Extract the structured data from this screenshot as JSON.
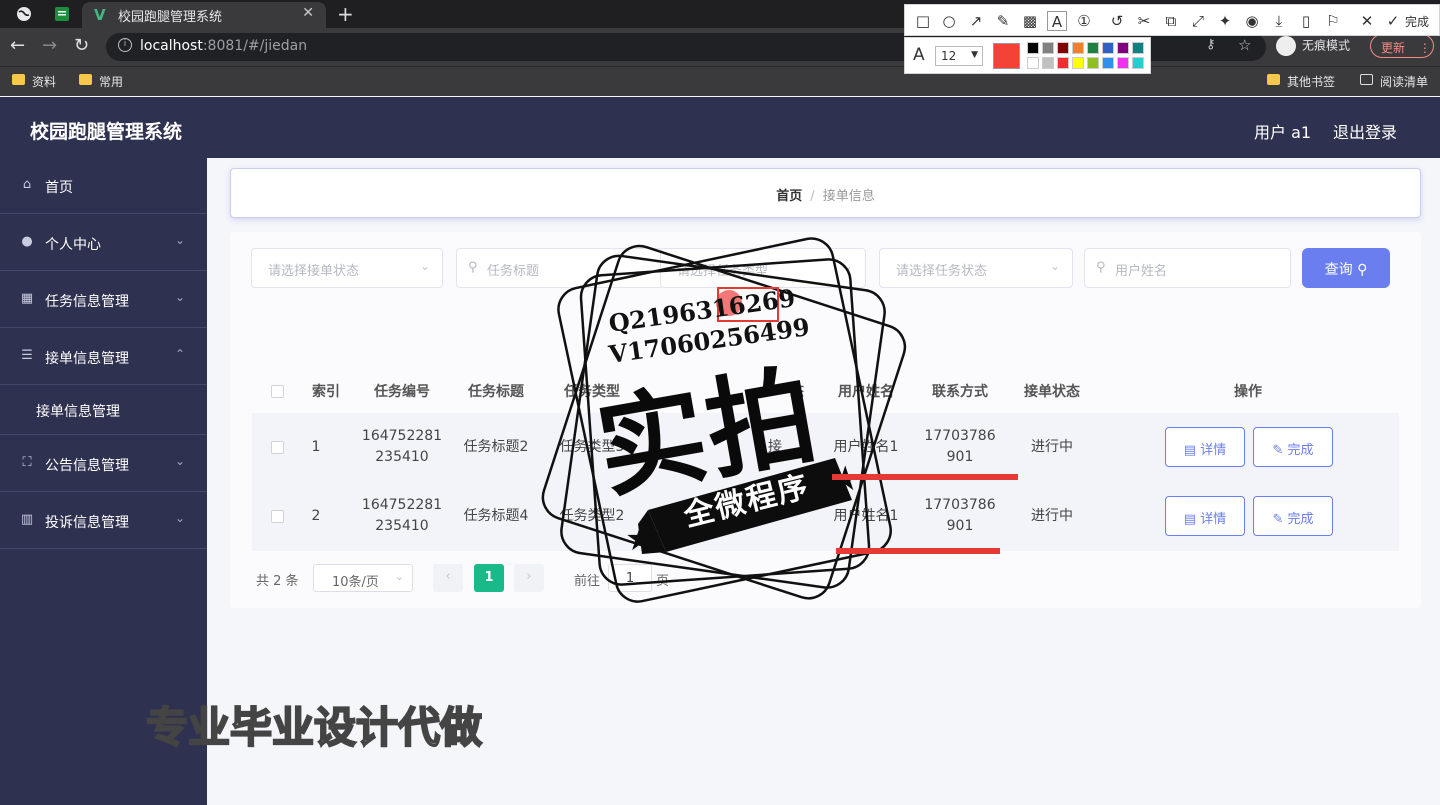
{
  "browser": {
    "tab_title": "校园跑腿管理系统",
    "url_host": "localhost",
    "url_rest": ":8081/#/jiedan",
    "incognito_label": "无痕模式",
    "update_label": "更新",
    "bookmarks": [
      "资料",
      "常用",
      "其他书签",
      "阅读清单"
    ]
  },
  "snip_tool": {
    "done_label": "完成",
    "font_size": "12",
    "current_color": "#f44336",
    "palette": [
      "#000000",
      "#808080",
      "#800000",
      "#f08030",
      "#208040",
      "#3060c0",
      "#800080",
      "#108080",
      "#ffffff",
      "#c0c0c0",
      "#f03030",
      "#ffff00",
      "#90c020",
      "#3090f0",
      "#f030f0",
      "#20d0d0"
    ]
  },
  "header": {
    "app_title": "校园跑腿管理系统",
    "user_label": "用户 a1",
    "logout_label": "退出登录"
  },
  "sidebar": {
    "items": [
      {
        "label": "首页",
        "icon": "home-icon"
      },
      {
        "label": "个人中心",
        "icon": "user-icon"
      },
      {
        "label": "任务信息管理",
        "icon": "grid-icon"
      },
      {
        "label": "接单信息管理",
        "icon": "list-icon"
      },
      {
        "label": "公告信息管理",
        "icon": "frame-icon"
      },
      {
        "label": "投诉信息管理",
        "icon": "chart-icon"
      }
    ],
    "submenu_item": "接单信息管理"
  },
  "breadcrumb": {
    "home": "首页",
    "separator": "/",
    "current": "接单信息"
  },
  "filters": {
    "order_status": "请选择接单状态",
    "task_title": "任务标题",
    "task_type": "请选择任务类型",
    "task_status": "请选择任务状态",
    "user_name": "用户姓名",
    "query_label": "查询"
  },
  "table": {
    "headers": {
      "index": "索引",
      "task_no": "任务编号",
      "task_title": "任务标题",
      "task_type": "任务类型",
      "status_partial": "态",
      "user_name": "用户姓名",
      "contact": "联系方式",
      "order_status": "接单状态",
      "actions": "操作"
    },
    "rows": [
      {
        "index": "1",
        "task_no_l1": "164752281",
        "task_no_l2": "235410",
        "task_title": "任务标题2",
        "task_type": "任务类型3",
        "status_partial": "接",
        "user_name": "用户姓名1",
        "contact_l1": "17703786",
        "contact_l2": "901",
        "order_status": "进行中"
      },
      {
        "index": "2",
        "task_no_l1": "164752281",
        "task_no_l2": "235410",
        "task_title": "任务标题4",
        "task_type": "任务类型2",
        "status_partial": "",
        "user_name": "用户姓名1",
        "contact_l1": "17703786",
        "contact_l2": "901",
        "order_status": "进行中"
      }
    ],
    "detail_label": "详情",
    "finish_label": "完成"
  },
  "pagination": {
    "total": "共 2 条",
    "page_size": "10条/页",
    "current_page": "1",
    "goto_label": "前往",
    "goto_value": "1",
    "page_unit": "页"
  },
  "watermark": {
    "qq": "Q2196316269",
    "wechat": "V17060256499",
    "big_text": "实拍",
    "ribbon_text": "全微程序",
    "bottom_text": "专业毕业设计代做"
  }
}
